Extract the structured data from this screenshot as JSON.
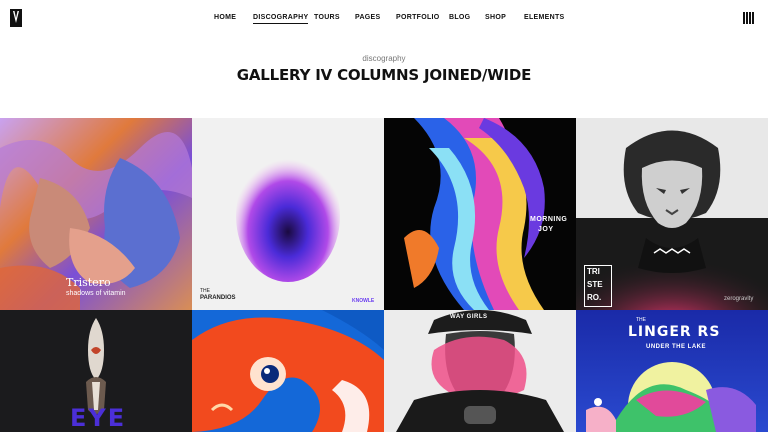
{
  "nav": {
    "items": [
      "HOME",
      "DISCOGRAPHY",
      "TOURS",
      "PAGES",
      "PORTFOLIO",
      "BLOG",
      "SHOP",
      "ELEMENTS"
    ],
    "active": "DISCOGRAPHY"
  },
  "page": {
    "eyebrow": "discography",
    "title": "GALLERY IV COLUMNS JOINED/WIDE"
  },
  "gallery": {
    "tiles": [
      {
        "name": "album-tristero",
        "lines": [
          "Tristero",
          "shadows of vitamin"
        ]
      },
      {
        "name": "album-the-parandios",
        "lines": [
          "THE",
          "PARANDIOS",
          "KNOWLE"
        ]
      },
      {
        "name": "album-morning-joy",
        "lines": [
          "MORNING",
          "JOY"
        ]
      },
      {
        "name": "album-triste-ro",
        "lines": [
          "TRI",
          "STE",
          "RO.",
          "zerogravity"
        ]
      },
      {
        "name": "album-eye",
        "lines": [
          "EYE"
        ]
      },
      {
        "name": "album-fish-art",
        "lines": []
      },
      {
        "name": "album-portrait-hat",
        "lines": [
          "WAY GIRLS"
        ]
      },
      {
        "name": "album-the-lingerers",
        "lines": [
          "LINGER RS",
          "THE",
          "UNDER THE LAKE"
        ]
      }
    ]
  }
}
